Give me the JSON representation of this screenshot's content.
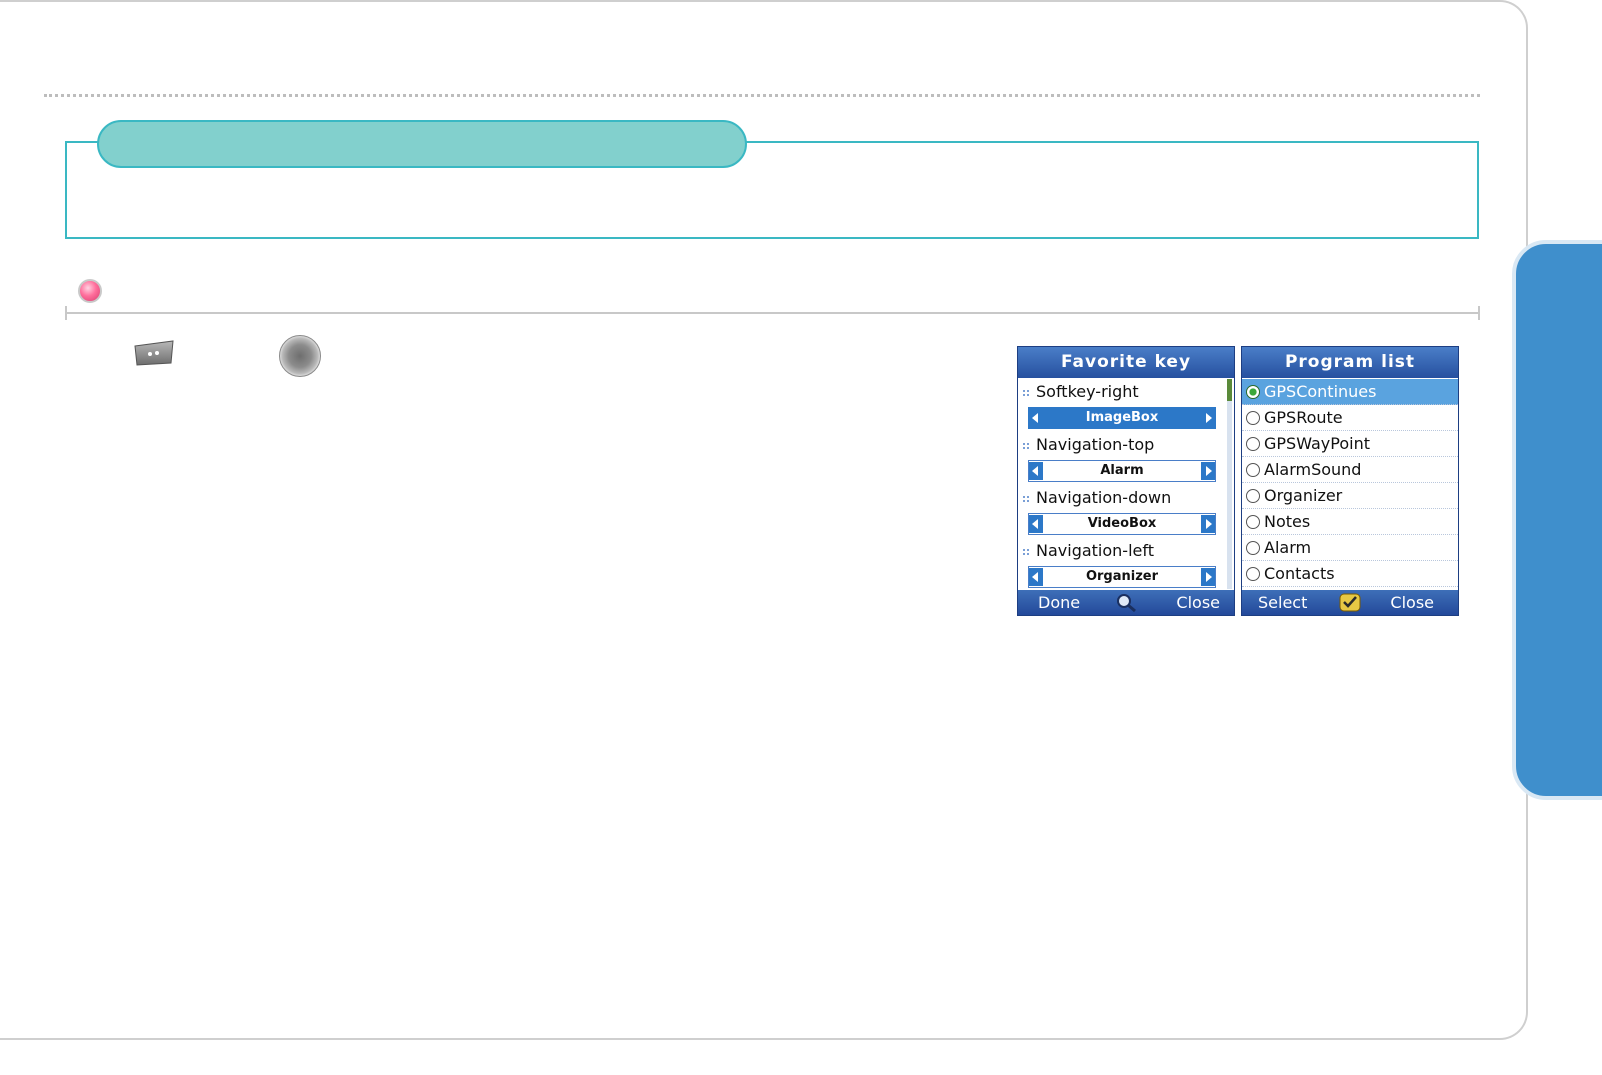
{
  "section": {
    "heading": "",
    "description": ""
  },
  "subsection": {
    "title": ""
  },
  "body_text": "",
  "icons": {
    "bullet": "pink-bullet-icon",
    "softkey": "right-soft-key-icon",
    "navigation_key": "navigation-key-icon",
    "search": "magnifier-icon",
    "confirm": "checkmark-icon"
  },
  "colors": {
    "section_accent": "#3ab8c3",
    "section_tab_fill": "#82d0cd",
    "side_tab": "#3f8fcc",
    "phone_title": "#26509f",
    "phone_highlight": "#2c78c8"
  },
  "favorite_screen": {
    "title": "Favorite key",
    "items": [
      {
        "label": "Softkey-right",
        "value": "ImageBox",
        "active": true
      },
      {
        "label": "Navigation-top",
        "value": "Alarm",
        "active": false
      },
      {
        "label": "Navigation-down",
        "value": "VideoBox",
        "active": false
      },
      {
        "label": "Navigation-left",
        "value": "Organizer",
        "active": false
      }
    ],
    "softkeys": {
      "left": "Done",
      "right": "Close"
    }
  },
  "program_screen": {
    "title": "Program list",
    "items": [
      {
        "label": "GPSContinues",
        "selected": true
      },
      {
        "label": "GPSRoute",
        "selected": false
      },
      {
        "label": "GPSWayPoint",
        "selected": false
      },
      {
        "label": "AlarmSound",
        "selected": false
      },
      {
        "label": "Organizer",
        "selected": false
      },
      {
        "label": "Notes",
        "selected": false
      },
      {
        "label": "Alarm",
        "selected": false
      },
      {
        "label": "Contacts",
        "selected": false
      }
    ],
    "softkeys": {
      "left": "Select",
      "right": "Close"
    }
  }
}
